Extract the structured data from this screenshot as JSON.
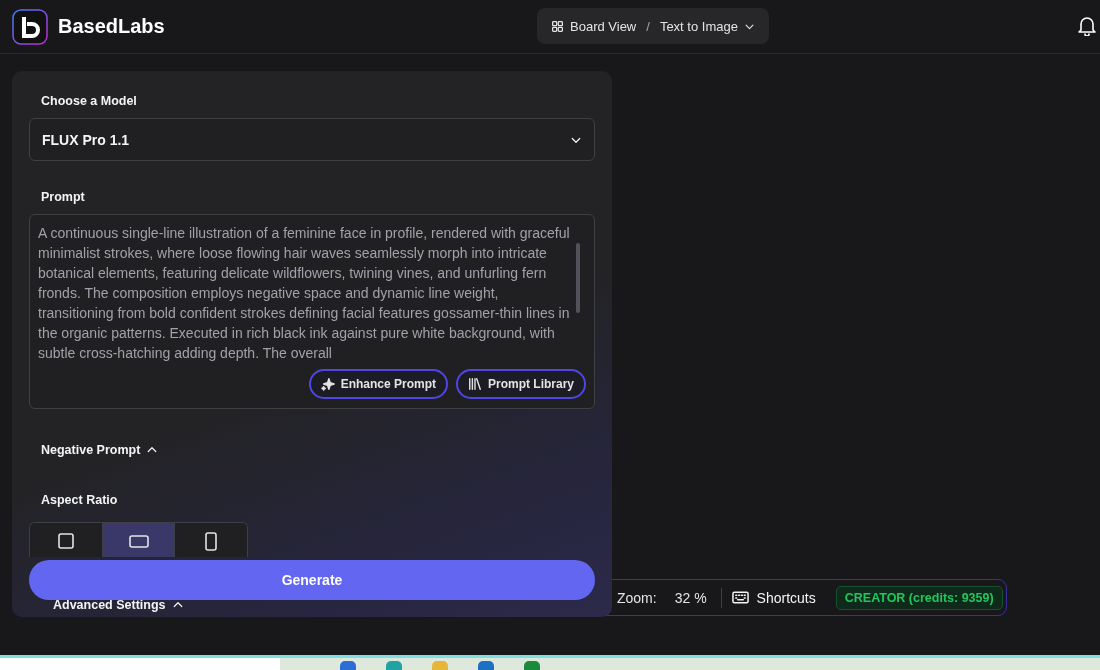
{
  "header": {
    "brand": "BasedLabs",
    "breadcrumb_separator": "/",
    "breadcrumb": [
      {
        "label": "Board View",
        "kind": "board"
      },
      {
        "label": "Text to Image",
        "kind": "dropdown"
      }
    ]
  },
  "panel": {
    "model_label": "Choose a Model",
    "model": "FLUX Pro 1.1",
    "prompt_label": "Prompt",
    "prompt": "A continuous single-line illustration of a feminine face in profile, rendered with graceful minimalist strokes, where loose flowing hair waves seamlessly morph into intricate botanical elements, featuring delicate wildflowers, twining vines, and unfurling fern fronds. The composition employs negative space and dynamic line weight, transitioning from bold confident strokes defining facial features gossamer-thin lines in the organic patterns. Executed in rich black ink against pure white background, with subtle cross-hatching adding depth. The overall",
    "prompt_buttons": [
      {
        "label": "Enhance Prompt",
        "kind": "sparkle"
      },
      {
        "label": "Prompt Library",
        "kind": "library"
      }
    ],
    "negative_prompt": {
      "label": "Negative Prompt",
      "expanded": false
    },
    "aspect_label": "Aspect Ratio",
    "aspect_options": [
      {
        "kind": "square",
        "selected": false
      },
      {
        "kind": "landscape",
        "selected": true
      },
      {
        "kind": "portrait",
        "selected": false
      }
    ],
    "generate": "Generate",
    "advanced": {
      "label": "Advanced Settings",
      "expanded": false
    }
  },
  "status_bar": {
    "zoom_label": "Zoom:",
    "zoom": "32 %",
    "shortcuts": "Shortcuts",
    "plan": "CREATOR (credits: 9359)"
  }
}
